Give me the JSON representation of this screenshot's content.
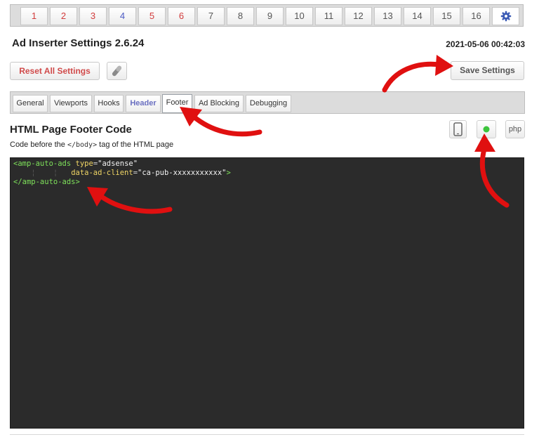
{
  "block_tabs": [
    "1",
    "2",
    "3",
    "4",
    "5",
    "6",
    "7",
    "8",
    "9",
    "10",
    "11",
    "12",
    "13",
    "14",
    "15",
    "16"
  ],
  "header": {
    "title": "Ad Inserter Settings 2.6.24",
    "timestamp": "2021-05-06 00:42:03",
    "reset_label": "Reset All Settings",
    "save_label": "Save Settings"
  },
  "settings_tabs": [
    "General",
    "Viewports",
    "Hooks",
    "Header",
    "Footer",
    "Ad Blocking",
    "Debugging"
  ],
  "active_settings_tab": "Footer",
  "section": {
    "title": "HTML Page Footer Code",
    "subtitle_before": "Code before the ",
    "subtitle_code": "</body>",
    "subtitle_after": " tag of the HTML page"
  },
  "icons": {
    "phone": "mobile-phone-icon",
    "status": "status-dot-icon",
    "php_label": "php"
  },
  "code": {
    "line1_tag": "<amp-auto-ads",
    "line1_attr": "type",
    "line1_val": "\"adsense\"",
    "line2_attr": "data-ad-client",
    "line2_val": "\"ca-pub-xxxxxxxxxxx\"",
    "line2_close": ">",
    "line3": "</amp-auto-ads>"
  },
  "colors": {
    "arrow": "#e01010",
    "editor_bg": "#2b2b2b",
    "tag": "#7ee05a",
    "attr": "#f0d565",
    "status_dot": "#3cc43c",
    "gear": "#3b5bb5"
  }
}
